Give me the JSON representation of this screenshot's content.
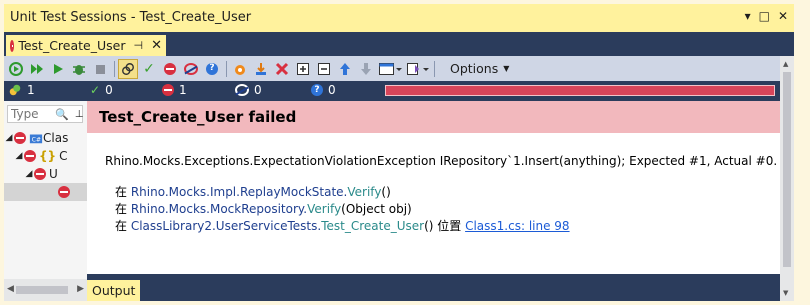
{
  "window": {
    "title": "Unit Test Sessions - Test_Create_User",
    "buttons": [
      "▾",
      "□",
      "✕"
    ]
  },
  "tab": {
    "label": "Test_Create_User",
    "pin": "⊣",
    "close": "✕"
  },
  "toolbar": {
    "options_label": "Options",
    "icons": [
      "run-all-icon",
      "run-dropdown-icon",
      "run-icon",
      "debug-icon",
      "stop-icon",
      "track-session-icon",
      "show-passed-icon",
      "show-failed-icon",
      "show-ignored-icon",
      "show-unknown-icon",
      "dotcover-icon",
      "export-icon",
      "remove-icon",
      "expand-all-icon",
      "collapse-all-icon",
      "previous-icon",
      "next-icon",
      "layout-icon",
      "group-by-icon"
    ]
  },
  "status": {
    "total": "1",
    "passed": "0",
    "failed": "1",
    "ignored": "0",
    "unknown": "0",
    "progress_color": "#d8455a"
  },
  "tree": {
    "search_placeholder": "Type",
    "rows": [
      {
        "label": "Clas",
        "level": 0
      },
      {
        "label": "C",
        "level": 1
      },
      {
        "label": "U",
        "level": 2
      },
      {
        "label": "",
        "level": 3
      }
    ]
  },
  "detail": {
    "heading": "Test_Create_User failed",
    "message": "Rhino.Mocks.Exceptions.ExpectationViolationException IRepository`1.Insert(anything); Expected #1, Actual #0.",
    "stack": [
      {
        "prefix": "在 ",
        "ns": "Rhino.Mocks.Impl.ReplayMockState.",
        "method": "Verify",
        "args": "()",
        "suffix": "",
        "link": ""
      },
      {
        "prefix": "在 ",
        "ns": "Rhino.Mocks.MockRepository.",
        "method": "Verify",
        "args": "(Object obj)",
        "suffix": "",
        "link": ""
      },
      {
        "prefix": "在 ",
        "ns": "ClassLibrary2.UserServiceTests.",
        "method": "Test_Create_User",
        "args": "()",
        "suffix": " 位置 ",
        "link": "Class1.cs: line 98"
      }
    ]
  },
  "output_tab": "Output",
  "colors": {
    "panel": "#2b3c5c",
    "active_yellow": "#fff29d",
    "toolbar": "#cfd6e5",
    "fail_banner": "#f2b8bd"
  }
}
